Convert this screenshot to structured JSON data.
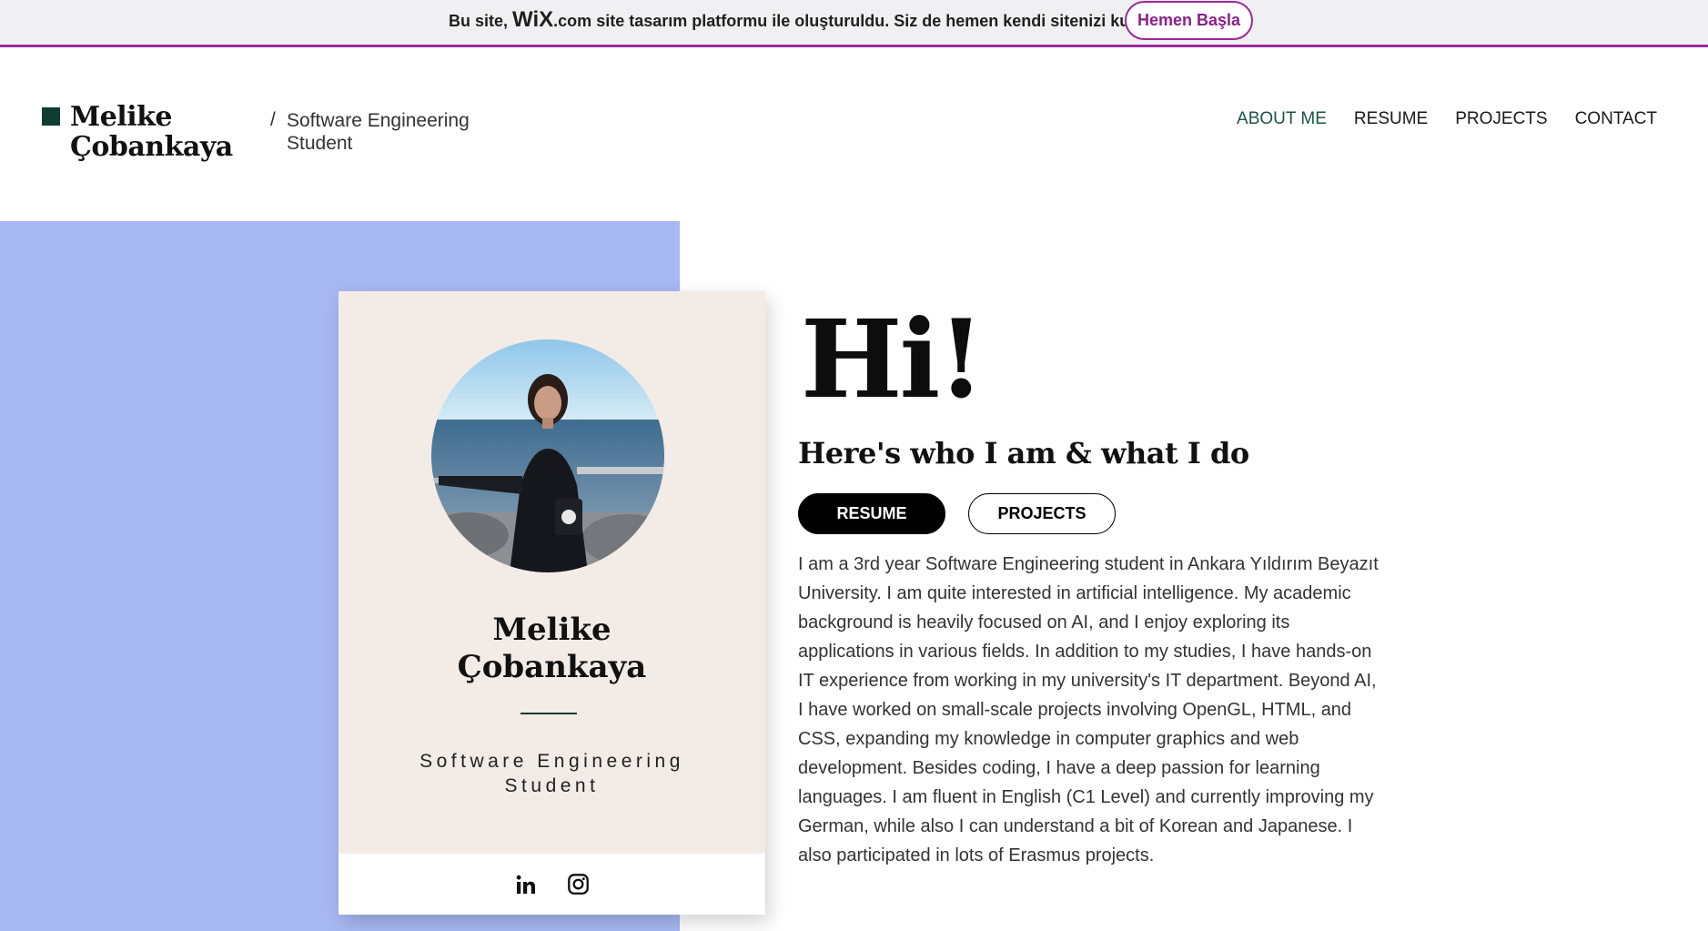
{
  "wix_banner": {
    "text_before": "Bu site,",
    "logo": "WiX",
    "logo_suffix": ".com",
    "text_after": "site tasarım platformu ile oluşturuldu. Siz de hemen kendi sitenizi kurun.",
    "cta_label": "Hemen Başla",
    "accent_color": "#9b2a9b"
  },
  "header": {
    "site_name_line1": "Melike",
    "site_name_line2": "Çobankaya",
    "separator": "/",
    "tagline_line1": "Software Engineering",
    "tagline_line2": "Student",
    "nav": [
      {
        "label": "ABOUT ME",
        "active": true
      },
      {
        "label": "RESUME",
        "active": false
      },
      {
        "label": "PROJECTS",
        "active": false
      },
      {
        "label": "CONTACT",
        "active": false
      }
    ]
  },
  "card": {
    "avatar_icon": "profile-photo",
    "name_line1": "Melike",
    "name_line2": "Çobankaya",
    "role_line1": "Software Engineering",
    "role_line2": "Student",
    "social": [
      {
        "name": "linkedin-icon"
      },
      {
        "name": "instagram-icon"
      }
    ]
  },
  "main": {
    "greeting": "Hi!",
    "subtitle": "Here's who I am & what I do",
    "resume_button": "RESUME",
    "projects_button": "PROJECTS",
    "about_text": "I am a 3rd year Software Engineering student in Ankara Yıldırım Beyazıt University. I am quite interested in artificial intelligence. My academic background is heavily focused on AI, and I enjoy exploring its applications in various fields. In addition to my studies, I have hands-on IT experience from working in my university's IT department. Beyond AI, I have worked on small-scale projects involving OpenGL, HTML, and CSS, expanding my knowledge in computer graphics and web development. Besides coding, I have a deep passion for learning languages. I am fluent in English (C1 Level) and currently improving my German, while also I can understand a bit of Korean and Japanese. I also participated in lots of Erasmus projects."
  },
  "colors": {
    "panel_blue": "#a8b8f2",
    "card_beige": "#f2ebe6",
    "brand_green": "#0f3d32"
  }
}
